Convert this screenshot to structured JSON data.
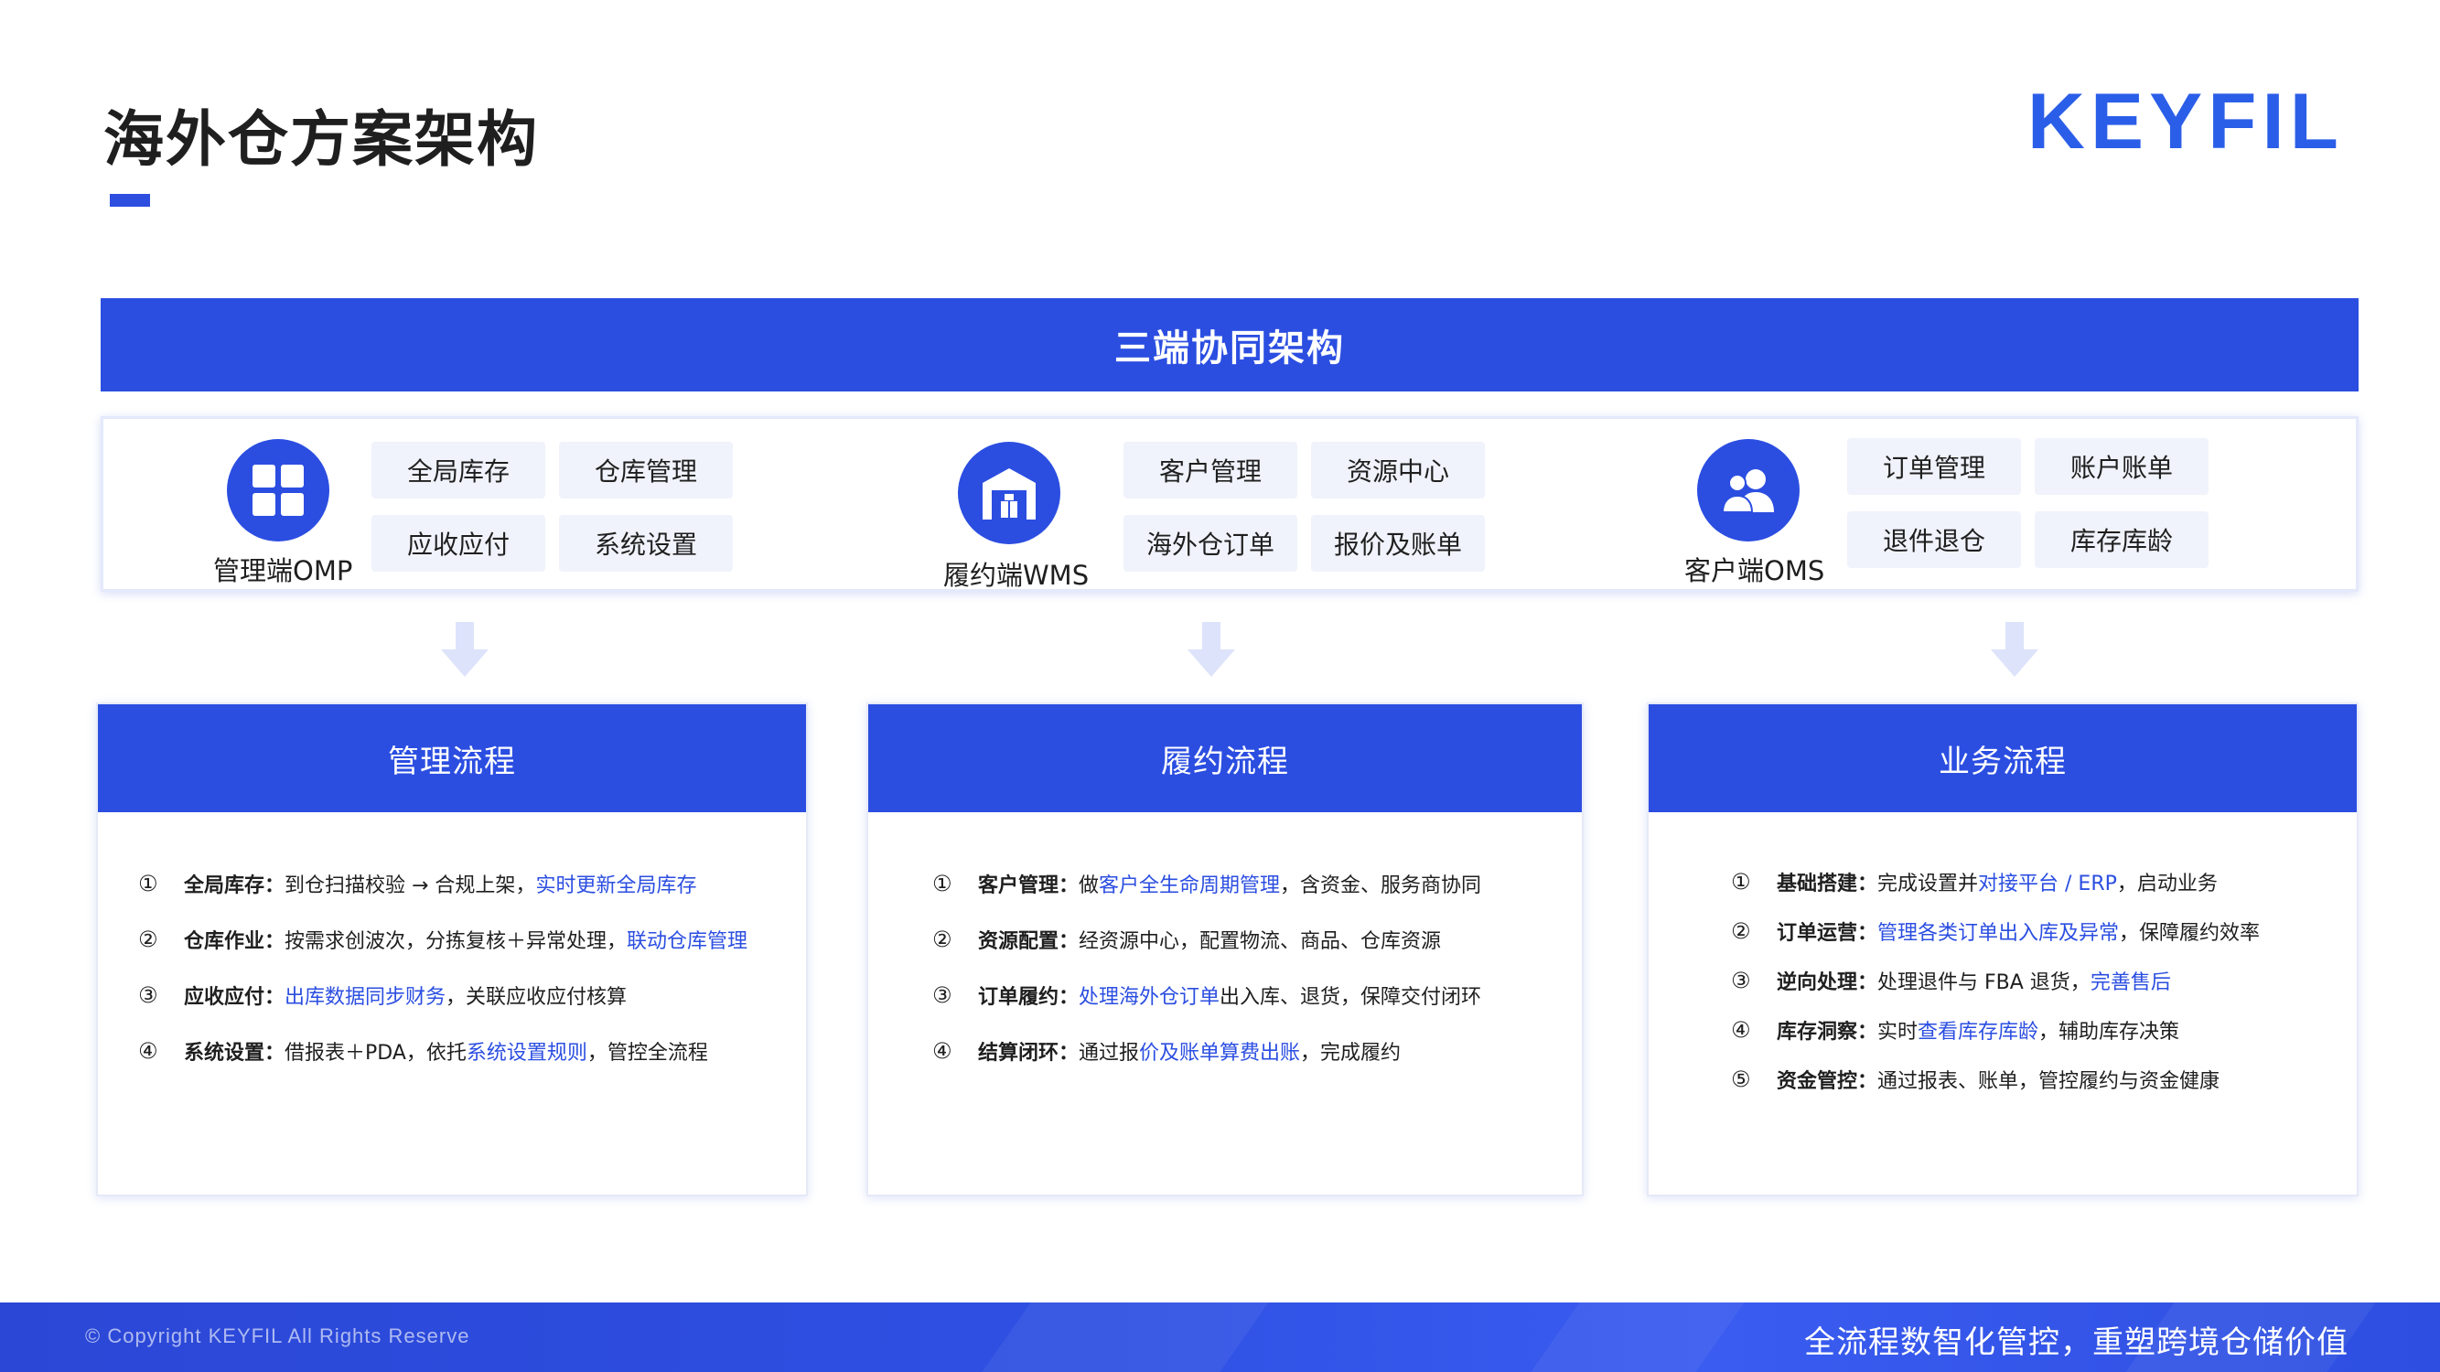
{
  "page": {
    "title": "海外仓方案架构",
    "brand": "KEYFIL",
    "accent_color": "#2b4ee1"
  },
  "banner": {
    "title": "三端协同架构"
  },
  "platforms": [
    {
      "name": "管理端OMP",
      "icon": "grid-icon",
      "modules": [
        "全局库存",
        "仓库管理",
        "应收应付",
        "系统设置"
      ]
    },
    {
      "name": "履约端WMS",
      "icon": "warehouse-icon",
      "modules": [
        "客户管理",
        "资源中心",
        "海外仓订单",
        "报价及账单"
      ]
    },
    {
      "name": "客户端OMS",
      "icon": "users-icon",
      "modules": [
        "订单管理",
        "账户账单",
        "退件退仓",
        "库存库龄"
      ]
    }
  ],
  "flows": [
    {
      "title": "管理流程",
      "items": [
        {
          "num": "①",
          "key": "全局库存：",
          "text": "到仓扫描校验 → 合规上架，",
          "hl": "实时更新全局库存",
          "tail": ""
        },
        {
          "num": "②",
          "key": "仓库作业：",
          "text": "按需求创波次，分拣复核＋异常处理，",
          "hl": "联动仓库管理",
          "tail": ""
        },
        {
          "num": "③",
          "key": "应收应付：",
          "text": "",
          "hl": "出库数据同步财务",
          "tail": "，关联应收应付核算"
        },
        {
          "num": "④",
          "key": "系统设置：",
          "text": "借报表＋PDA，依托",
          "hl": "系统设置规则",
          "tail": "，管控全流程"
        }
      ]
    },
    {
      "title": "履约流程",
      "items": [
        {
          "num": "①",
          "key": "客户管理：",
          "text": "做",
          "hl": "客户全生命周期管理",
          "tail": "，含资金、服务商协同"
        },
        {
          "num": "②",
          "key": "资源配置：",
          "text": "经资源中心，配置物流、商品、仓库资源",
          "hl": "",
          "tail": ""
        },
        {
          "num": "③",
          "key": "订单履约：",
          "text": "",
          "hl": "处理海外仓订单",
          "tail": "出入库、退货，保障交付闭环"
        },
        {
          "num": "④",
          "key": "结算闭环：",
          "text": "通过报",
          "hl": "价及账单算费出账",
          "tail": "，完成履约"
        }
      ]
    },
    {
      "title": "业务流程",
      "items": [
        {
          "num": "①",
          "key": "基础搭建：",
          "text": "完成设置并",
          "hl": "对接平台 / ERP",
          "tail": "，启动业务"
        },
        {
          "num": "②",
          "key": "订单运营：",
          "text": "",
          "hl": "管理各类订单出入库及异常",
          "tail": "，保障履约效率"
        },
        {
          "num": "③",
          "key": "逆向处理：",
          "text": "处理退件与 FBA 退货，",
          "hl": "完善售后",
          "tail": ""
        },
        {
          "num": "④",
          "key": "库存洞察：",
          "text": "实时",
          "hl": "查看库存库龄",
          "tail": "，辅助库存决策"
        },
        {
          "num": "⑤",
          "key": "资金管控：",
          "text": "通过报表、账单，管控履约与资金健康",
          "hl": "",
          "tail": ""
        }
      ]
    }
  ],
  "footer": {
    "copyright": "© Copyright KEYFIL  All Rights Reserve",
    "slogan": "全流程数智化管控，重塑跨境仓储价值"
  }
}
